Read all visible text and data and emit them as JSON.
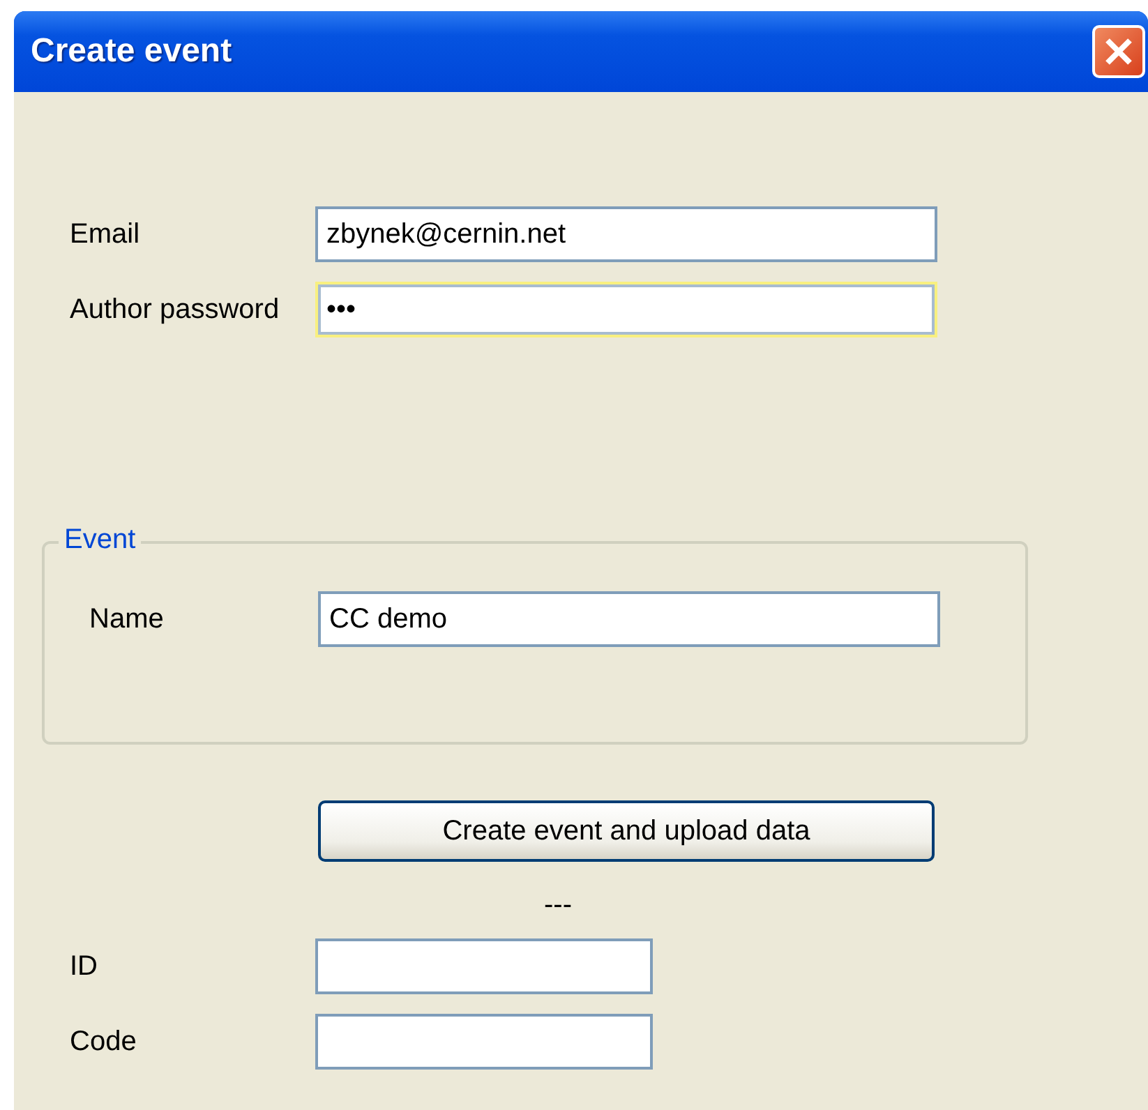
{
  "window": {
    "title": "Create event"
  },
  "fields": [
    {
      "label": "Email",
      "value": "zbynek@cernin.net",
      "focused": false
    },
    {
      "label": "Author password",
      "value": "•••",
      "focused": true
    }
  ],
  "event_group": {
    "title": "Event",
    "fields": [
      {
        "label": "Name",
        "value": "CC demo",
        "focused": false
      }
    ]
  },
  "upload_button": "Create event and upload data",
  "status": "---",
  "result_fields": [
    {
      "label": "ID",
      "focused": false
    },
    {
      "label": "Code",
      "focused": false
    }
  ]
}
